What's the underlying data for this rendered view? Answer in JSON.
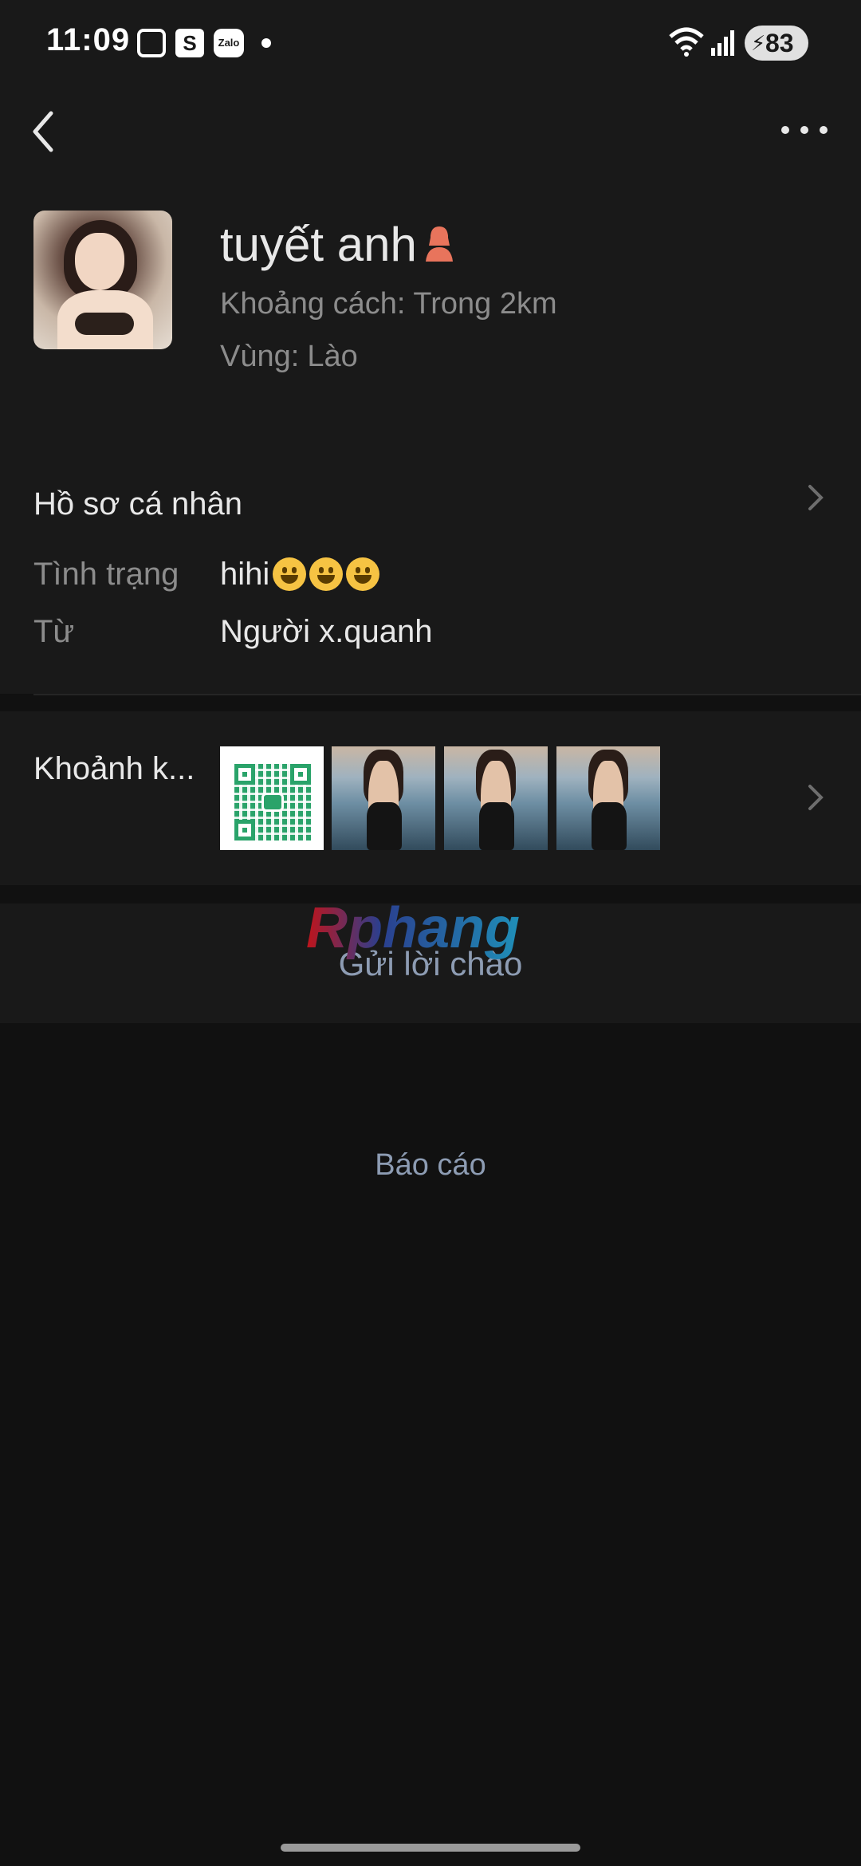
{
  "status_bar": {
    "time": "11:09",
    "zalo_icon_text": "Zalo",
    "shopee_icon_text": "S",
    "battery": "83"
  },
  "profile": {
    "name": "tuyết anh",
    "distance_label": "Khoảng cách:",
    "distance_value": "Trong 2km",
    "region_label": "Vùng:",
    "region_value": "Lào",
    "gender_icon": "female-user-icon",
    "gender_icon_color": "#e8745c"
  },
  "personal_profile": {
    "title": "Hồ sơ cá nhân",
    "status_label": "Tình trạng",
    "status_value": "hihi",
    "status_emoji_count": 3,
    "source_label": "Từ",
    "source_value": "Người x.quanh"
  },
  "moments": {
    "label": "Khoảnh k...",
    "thumbnails": [
      "qr-code",
      "photo",
      "photo",
      "photo"
    ]
  },
  "actions": {
    "greet": "Gửi lời chào",
    "report": "Báo cáo"
  },
  "watermark": "Rphang",
  "colors": {
    "background": "#111111",
    "card": "#191919",
    "link": "#8d9cb3"
  }
}
